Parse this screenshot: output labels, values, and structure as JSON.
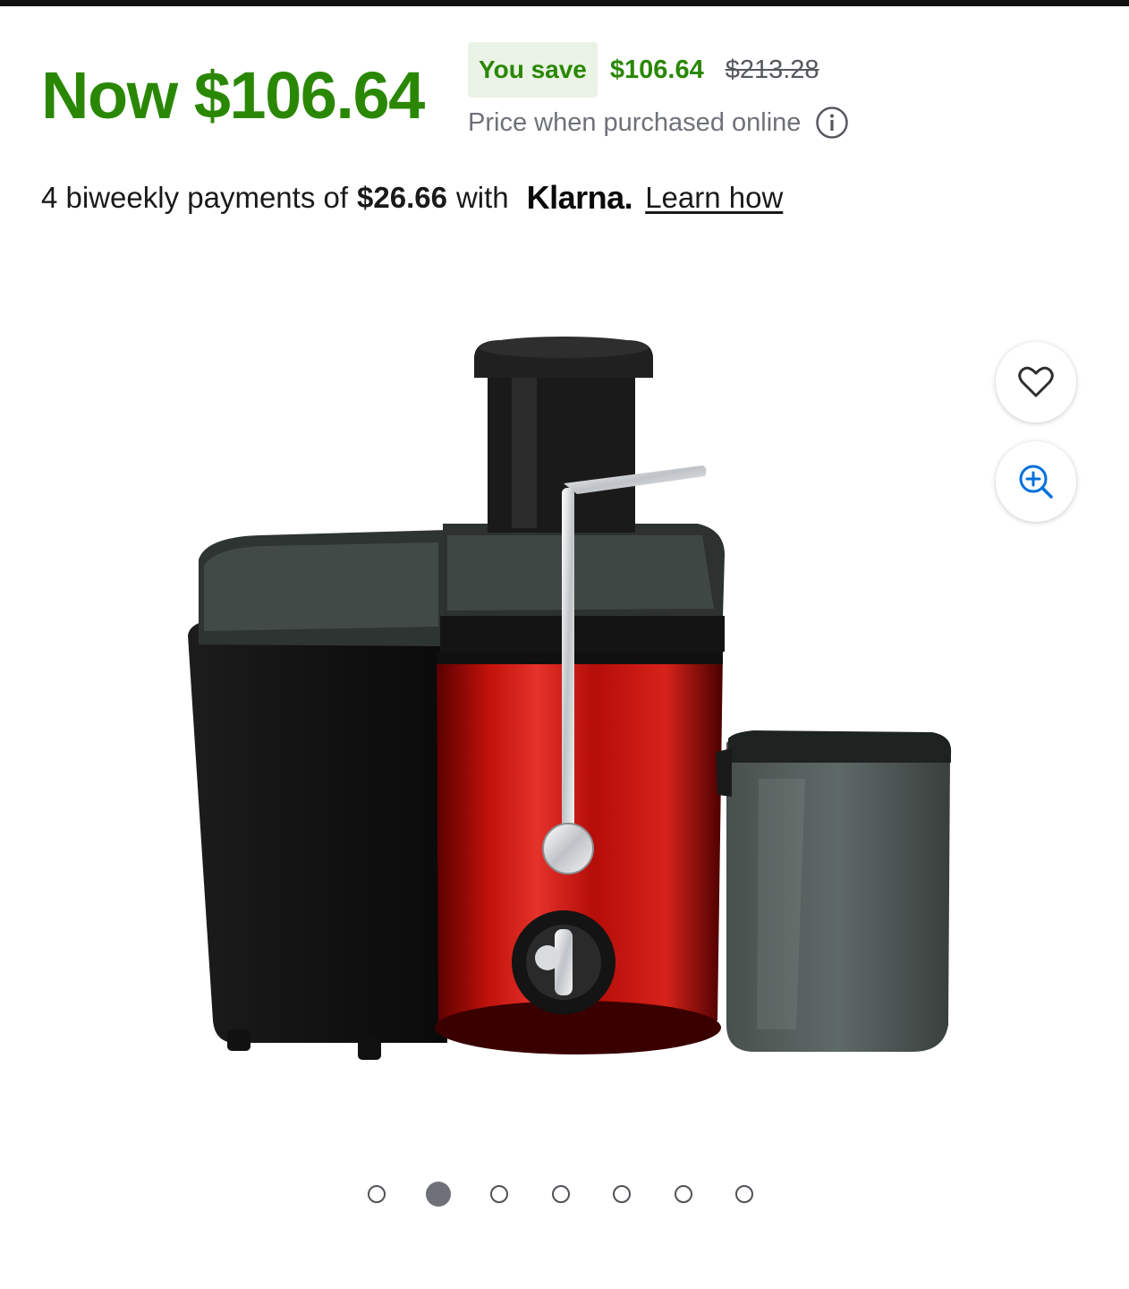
{
  "price": {
    "now_label": "Now $106.64",
    "save_badge": "You save",
    "save_amount": "$106.64",
    "was_price": "$213.28",
    "online_note": "Price when purchased online"
  },
  "klarna": {
    "prefix": "4 biweekly payments of",
    "amount": "$26.66",
    "with": "with",
    "logo": "Klarna.",
    "link": "Learn how"
  },
  "gallery": {
    "favorite_icon": "heart-icon",
    "zoom_icon": "zoom-in-icon",
    "dot_count": 7,
    "active_dot": 2
  },
  "colors": {
    "accent_green": "#2a8703",
    "badge_bg": "#eaf3e6",
    "link_blue": "#0071dc"
  }
}
